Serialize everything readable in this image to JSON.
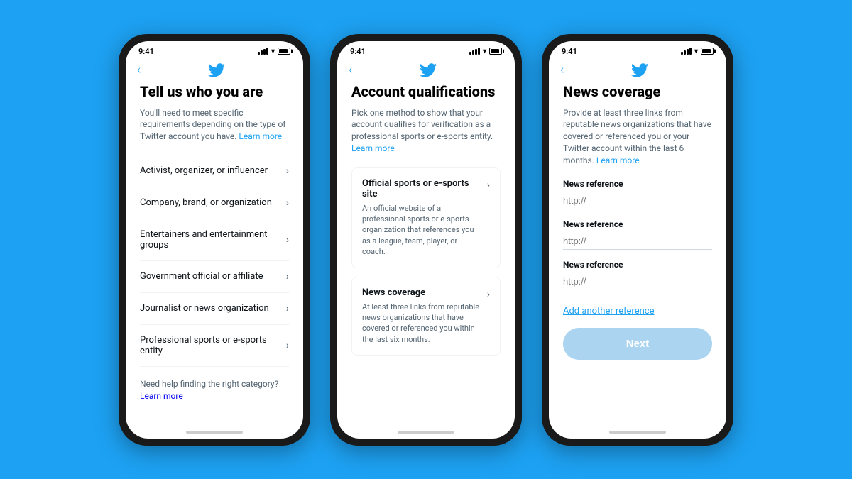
{
  "phone1": {
    "status_time": "9:41",
    "nav_back": "‹",
    "title": "Tell us who you are",
    "subtitle": "You'll need to meet specific requirements depending on the type of Twitter account you have.",
    "learn_more": "Learn more",
    "menu_items": [
      "Activist, organizer, or influencer",
      "Company, brand, or organization",
      "Entertainers and entertainment groups",
      "Government official or affiliate",
      "Journalist or news organization",
      "Professional sports or e-sports entity"
    ],
    "help_text": "Need help finding the right category?",
    "help_learn_more": "Learn more"
  },
  "phone2": {
    "status_time": "9:41",
    "nav_back": "‹",
    "title": "Account qualifications",
    "subtitle": "Pick one method to show that your account qualifies for verification as a professional sports or e-sports entity.",
    "learn_more": "Learn more",
    "items": [
      {
        "title": "Official sports or e-sports site",
        "desc": "An official website of a professional sports or e-sports organization that references you as a league, team, player, or coach."
      },
      {
        "title": "News coverage",
        "desc": "At least three links from reputable news organizations that have covered or referenced you within the last six months."
      }
    ]
  },
  "phone3": {
    "status_time": "9:41",
    "nav_back": "‹",
    "title": "News coverage",
    "subtitle": "Provide at least three links from reputable news organizations that have covered or referenced you or your Twitter account within the last 6 months.",
    "learn_more": "Learn more",
    "refs": [
      {
        "label": "News reference",
        "placeholder": "http://"
      },
      {
        "label": "News reference",
        "placeholder": "http://"
      },
      {
        "label": "News reference",
        "placeholder": "http://"
      }
    ],
    "add_reference": "Add another reference",
    "next_button": "Next"
  },
  "icons": {
    "chevron": "›",
    "back": "‹"
  }
}
